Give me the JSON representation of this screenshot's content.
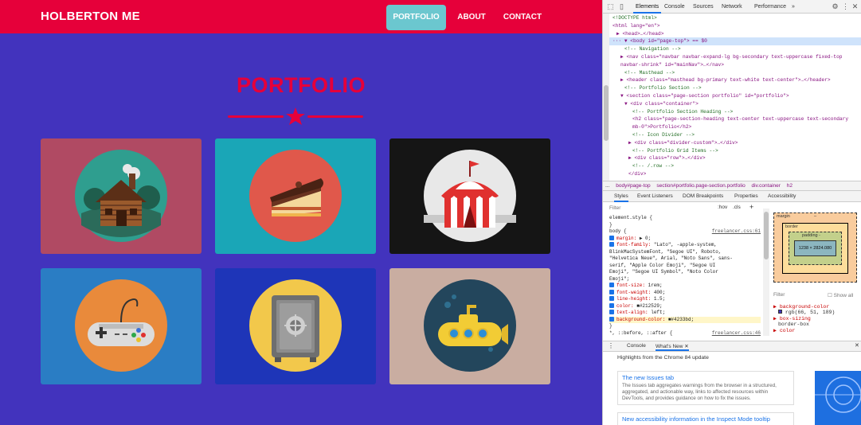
{
  "page": {
    "brand": "HOLBERTON ME",
    "nav": [
      {
        "label": "PORTFOLIO",
        "active": true
      },
      {
        "label": "ABOUT",
        "active": false
      },
      {
        "label": "CONTACT",
        "active": false
      }
    ],
    "heading": "PORTFOLIO",
    "colors": {
      "bg": "#4233bd",
      "navbar": "#e6003a",
      "accent": "#e6003a",
      "active_nav": "#6bc7cf"
    },
    "tiles": [
      {
        "subject": "cabin-icon",
        "bg": "#b04a63"
      },
      {
        "subject": "cake-icon",
        "bg": "#1aa6b7"
      },
      {
        "subject": "circus-tent-icon",
        "bg": "#151515"
      },
      {
        "subject": "game-controller-icon",
        "bg": "#2a7dc4"
      },
      {
        "subject": "safe-icon",
        "bg": "#1e35b8"
      },
      {
        "subject": "submarine-icon",
        "bg": "#c9ada1"
      }
    ]
  },
  "devtools": {
    "tabs": [
      "Elements",
      "Console",
      "Sources",
      "Network",
      "Performance",
      "»"
    ],
    "dom": [
      {
        "text": "<!DOCTYPE html>",
        "indent": 0,
        "type": "comment"
      },
      {
        "text": "<html lang=\"en\">",
        "indent": 0
      },
      {
        "text": "▶ <head>…</head>",
        "indent": 1
      },
      {
        "text": "··· ▼ <body id=\"page-top\"> == $0",
        "indent": 0,
        "selected": true
      },
      {
        "text": "<!-- Navigation -->",
        "indent": 3,
        "type": "comment"
      },
      {
        "text": "▶ <nav class=\"navbar navbar-expand-lg bg-secondary text-uppercase fixed-top",
        "indent": 2
      },
      {
        "text": "navbar-shrink\" id=\"mainNav\">…</nav>",
        "indent": 2
      },
      {
        "text": "<!-- Masthead -->",
        "indent": 3,
        "type": "comment"
      },
      {
        "text": "▶ <header class=\"masthead bg-primary text-white text-center\">…</header>",
        "indent": 2
      },
      {
        "text": "<!-- Portfolio Section -->",
        "indent": 3,
        "type": "comment"
      },
      {
        "text": "▼ <section class=\"page-section portfolio\" id=\"portfolio\">",
        "indent": 2
      },
      {
        "text": "▼ <div class=\"container\">",
        "indent": 3
      },
      {
        "text": "<!-- Portfolio Section Heading -->",
        "indent": 5,
        "type": "comment"
      },
      {
        "text": "<h2 class=\"page-section-heading text-center text-uppercase text-secondary",
        "indent": 5
      },
      {
        "text": "mb-0\">Portfolio</h2>",
        "indent": 5
      },
      {
        "text": "<!-- Icon Divider -->",
        "indent": 5,
        "type": "comment"
      },
      {
        "text": "▶ <div class=\"divider-custom\">…</div>",
        "indent": 4
      },
      {
        "text": "<!-- Portfolio Grid Items -->",
        "indent": 5,
        "type": "comment"
      },
      {
        "text": "▶ <div class=\"row\">…</div>",
        "indent": 4
      },
      {
        "text": "<!-- /.row -->",
        "indent": 5,
        "type": "comment"
      },
      {
        "text": "</div>",
        "indent": 4
      }
    ],
    "breadcrumb": [
      "...",
      "body#page-top",
      "section#portfolio.page-section.portfolio",
      "div.container",
      "h2"
    ],
    "style_tabs": [
      "Styles",
      "Event Listeners",
      "DOM Breakpoints",
      "Properties",
      "Accessibility"
    ],
    "filter_placeholder": "Filter",
    "filter_hov": ":hov",
    "filter_cls": ".cls",
    "styles": [
      {
        "text": "element.style {",
        "plain": true
      },
      {
        "text": "}",
        "plain": true
      },
      {
        "text": "body {",
        "plain": true,
        "source": "freelancer.css:61"
      },
      {
        "prop": "margin",
        "value": "▶ 0;"
      },
      {
        "prop": "font-family",
        "value": "\"Lato\", -apple-system,"
      },
      {
        "text": "  BlinkMacSystemFont, \"Segoe UI\", Roboto,",
        "plain": true
      },
      {
        "text": "  \"Helvetica Neue\", Arial, \"Noto Sans\", sans-",
        "plain": true
      },
      {
        "text": "  serif, \"Apple Color Emoji\", \"Segoe UI",
        "plain": true
      },
      {
        "text": "  Emoji\", \"Segoe UI Symbol\", \"Noto Color",
        "plain": true
      },
      {
        "text": "  Emoji\";",
        "plain": true
      },
      {
        "prop": "font-size",
        "value": "1rem;"
      },
      {
        "prop": "font-weight",
        "value": "400;"
      },
      {
        "prop": "line-height",
        "value": "1.5;"
      },
      {
        "prop": "color",
        "value": "■#212529;"
      },
      {
        "prop": "text-align",
        "value": "left;"
      },
      {
        "prop": "background-color",
        "value": "■#4233bd;",
        "highlight": true
      },
      {
        "text": "}",
        "plain": true
      },
      {
        "text": "*, ::before, ::after {",
        "plain": true,
        "source": "freelancer.css:46"
      }
    ],
    "box_model": {
      "margin": "margin",
      "border": "border",
      "padding": "padding -",
      "content": "1238 × 2824.080",
      "dash": "–"
    },
    "computed_filter": "Filter",
    "show_all": "Show all",
    "computed": [
      {
        "prop": "background-color",
        "value": "rgb(66, 51, 189)"
      },
      {
        "prop": "box-sizing",
        "value": "border-box"
      },
      {
        "prop": "color",
        "value": ""
      }
    ],
    "drawer_tabs": [
      "Console",
      "What's New"
    ],
    "whats_new_title": "Highlights from the Chrome 84 update",
    "news": [
      {
        "title": "The new Issues tab",
        "body": "The Issues tab aggregates warnings from the browser in a structured, aggregated, and actionable way, links to affected resources within DevTools, and provides guidance on how to fix the issues."
      },
      {
        "title": "New accessibility information in the Inspect Mode tooltip",
        "body": ""
      }
    ]
  }
}
